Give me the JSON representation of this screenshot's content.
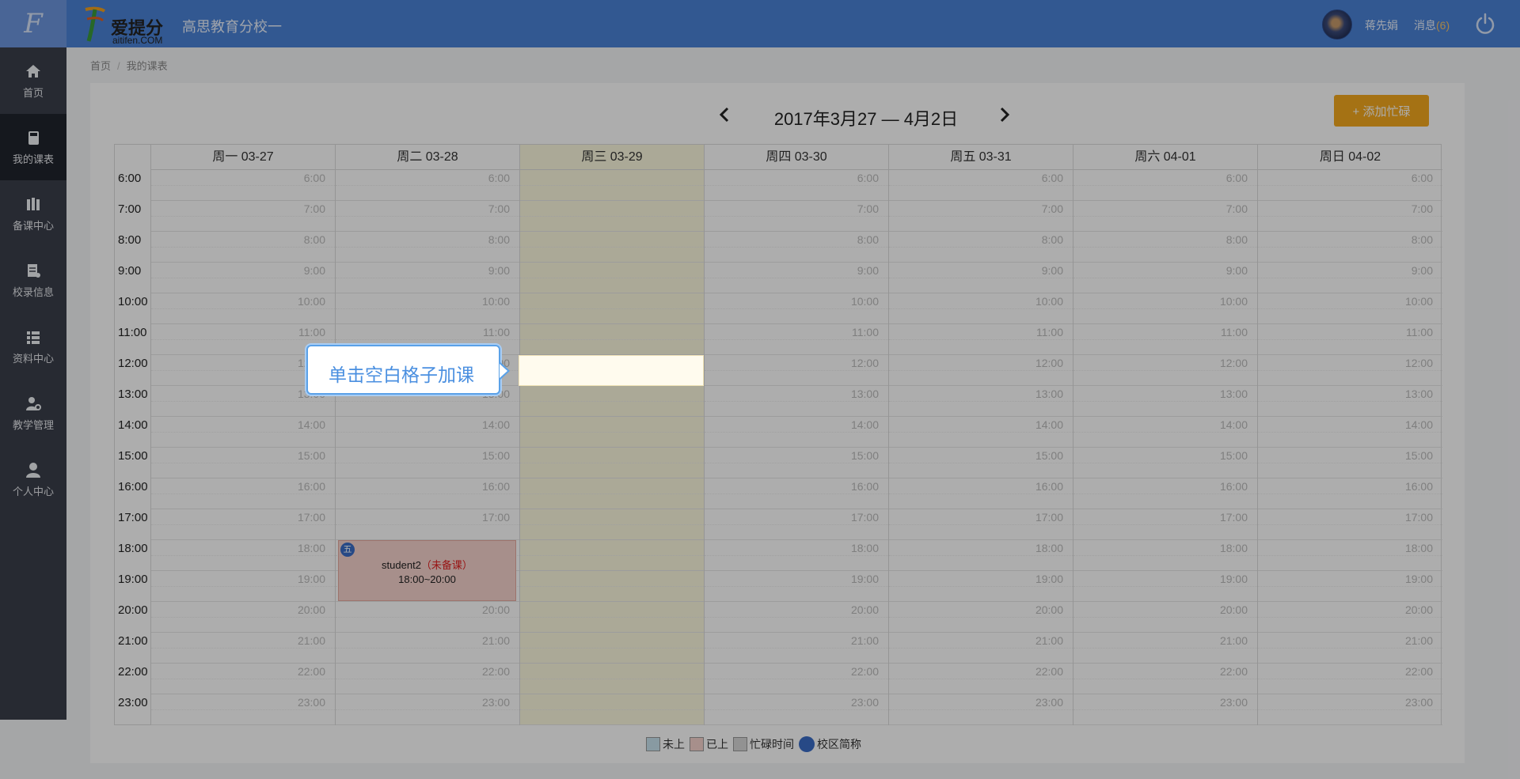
{
  "header": {
    "brand_name": "爱提分",
    "brand_url": "aitifen.COM",
    "school_name": "高思教育分校一",
    "username": "蒋先娟",
    "messages_label": "消息",
    "messages_count": "(6)"
  },
  "sidebar": {
    "items": [
      {
        "label": "首页",
        "icon": "home-icon"
      },
      {
        "label": "我的课表",
        "icon": "schedule-icon"
      },
      {
        "label": "备课中心",
        "icon": "books-icon"
      },
      {
        "label": "校录信息",
        "icon": "record-icon"
      },
      {
        "label": "资料中心",
        "icon": "list-icon"
      },
      {
        "label": "教学管理",
        "icon": "teacher-gear-icon"
      },
      {
        "label": "个人中心",
        "icon": "user-icon"
      }
    ]
  },
  "breadcrumb": {
    "home": "首页",
    "sep": "/",
    "current": "我的课表"
  },
  "week_nav": {
    "title": "2017年3月27 — 4月2日"
  },
  "add_busy_label": "+ 添加忙碌",
  "calendar": {
    "days": [
      {
        "label": "周一 03-27",
        "today": false
      },
      {
        "label": "周二 03-28",
        "today": false
      },
      {
        "label": "周三 03-29",
        "today": true
      },
      {
        "label": "周四 03-30",
        "today": false
      },
      {
        "label": "周五 03-31",
        "today": false
      },
      {
        "label": "周六 04-01",
        "today": false
      },
      {
        "label": "周日 04-02",
        "today": false
      }
    ],
    "hours": [
      "6:00",
      "7:00",
      "8:00",
      "9:00",
      "10:00",
      "11:00",
      "12:00",
      "13:00",
      "14:00",
      "15:00",
      "16:00",
      "17:00",
      "18:00",
      "19:00",
      "20:00",
      "21:00",
      "22:00",
      "23:00"
    ],
    "lessons": [
      {
        "day_index": 1,
        "start": "18:00",
        "end": "20:00",
        "badge": "五",
        "student": "student2",
        "status": "（未备课）",
        "time_range": "18:00~20:00"
      }
    ],
    "highlight": {
      "day_index": 2,
      "hour": "12:00"
    }
  },
  "legend": {
    "items": [
      {
        "label": "未上",
        "color": "#c9e4ef"
      },
      {
        "label": "已上",
        "color": "#f6d3cd"
      },
      {
        "label": "忙碌时间",
        "color": "#d8d8d8"
      },
      {
        "label": "校区简称",
        "color": "#3a6cc6"
      }
    ]
  },
  "tooltip": {
    "text": "单击空白格子加课"
  }
}
